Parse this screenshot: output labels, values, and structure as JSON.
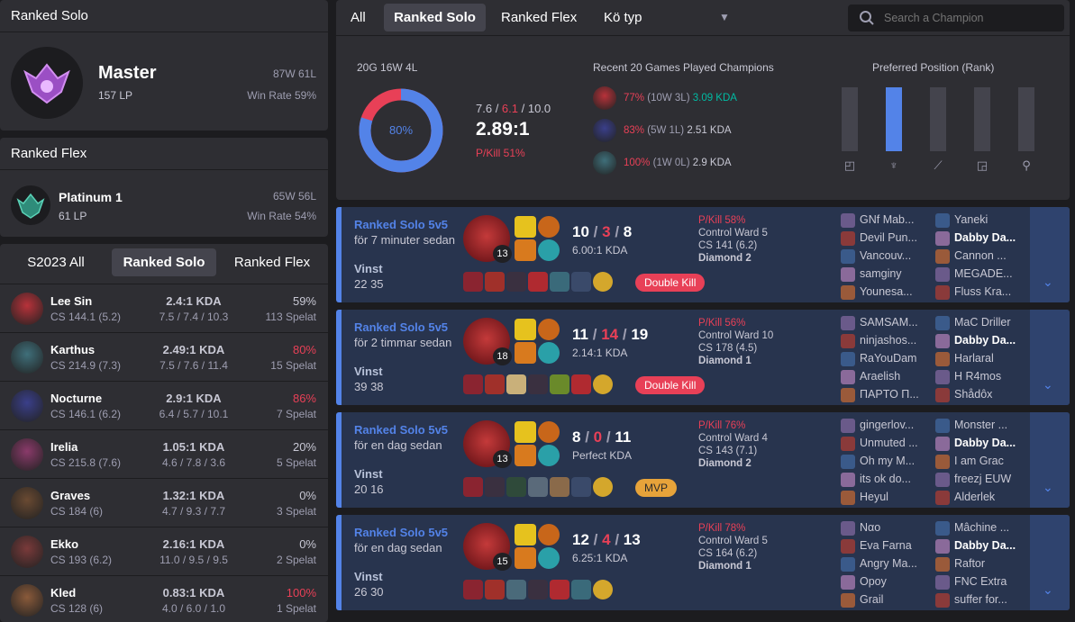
{
  "ranked_solo": {
    "title": "Ranked Solo",
    "tier": "Master",
    "lp": "157 LP",
    "record": "87W 61L",
    "winrate": "Win Rate 59%"
  },
  "ranked_flex": {
    "title": "Ranked Flex",
    "tier": "Platinum 1",
    "lp": "61 LP",
    "record": "65W 56L",
    "winrate": "Win Rate 54%"
  },
  "season_tabs": {
    "all": "S2023 All",
    "solo": "Ranked Solo",
    "flex": "Ranked Flex"
  },
  "champions": [
    {
      "name": "Lee Sin",
      "cs": "CS 144.1 (5.2)",
      "kda": "2.4:1 KDA",
      "stats": "7.5 / 7.4 / 10.3",
      "winrate": "59%",
      "games": "113 Spelat",
      "wr_color": "#c8c8d4",
      "icon_color": "#b8323a"
    },
    {
      "name": "Karthus",
      "cs": "CS 214.9 (7.3)",
      "kda": "2.49:1 KDA",
      "stats": "7.5 / 7.6 / 11.4",
      "winrate": "80%",
      "games": "15 Spelat",
      "wr_color": "#e84057",
      "icon_color": "#3f6f7a"
    },
    {
      "name": "Nocturne",
      "cs": "CS 146.1 (6.2)",
      "kda": "2.9:1 KDA",
      "stats": "6.4 / 5.7 / 10.1",
      "winrate": "86%",
      "games": "7 Spelat",
      "wr_color": "#e84057",
      "icon_color": "#3a3f8a"
    },
    {
      "name": "Irelia",
      "cs": "CS 215.8 (7.6)",
      "kda": "1.05:1 KDA",
      "stats": "4.6 / 7.8 / 3.6",
      "winrate": "20%",
      "games": "5 Spelat",
      "wr_color": "#c8c8d4",
      "icon_color": "#8a3a6a"
    },
    {
      "name": "Graves",
      "cs": "CS 184 (6)",
      "kda": "1.32:1 KDA",
      "stats": "4.7 / 9.3 / 7.7",
      "winrate": "0%",
      "games": "3 Spelat",
      "wr_color": "#c8c8d4",
      "icon_color": "#6a4a32"
    },
    {
      "name": "Ekko",
      "cs": "CS 193 (6.2)",
      "kda": "2.16:1 KDA",
      "stats": "11.0 / 9.5 / 9.5",
      "winrate": "0%",
      "games": "2 Spelat",
      "wr_color": "#c8c8d4",
      "icon_color": "#7a3a3a"
    },
    {
      "name": "Kled",
      "cs": "CS 128 (6)",
      "kda": "0.83:1 KDA",
      "stats": "4.0 / 6.0 / 1.0",
      "winrate": "100%",
      "games": "1 Spelat",
      "wr_color": "#e84057",
      "icon_color": "#8a5a3a"
    }
  ],
  "queue_tabs": {
    "all": "All",
    "solo": "Ranked Solo",
    "flex": "Ranked Flex",
    "type": "Kö typ"
  },
  "search": {
    "placeholder": "Search a Champion"
  },
  "summary": {
    "record": "20G 16W 4L",
    "donut_pct": "80%",
    "donut_value": 0.8,
    "kills": "7.6",
    "deaths": "6.1",
    "assists": "10.0",
    "ratio": "2.89:1",
    "pkill": "P/Kill 51%",
    "recent_title": "Recent 20 Games Played Champions",
    "recent": [
      {
        "wr": "77%",
        "rec": "(10W 3L)",
        "kda": "3.09 KDA",
        "kda_color": "#00bba3",
        "icon_color": "#b8323a"
      },
      {
        "wr": "83%",
        "rec": "(5W 1L)",
        "kda": "2.51 KDA",
        "kda_color": "#c8c8d4",
        "icon_color": "#3a3f8a"
      },
      {
        "wr": "100%",
        "rec": "(1W 0L)",
        "kda": "2.9 KDA",
        "kda_color": "#c8c8d4",
        "icon_color": "#3f6f7a"
      }
    ],
    "position_title": "Preferred Position (Rank)",
    "positions": [
      {
        "name": "top-icon",
        "share": 0
      },
      {
        "name": "jungle-icon",
        "share": 1
      },
      {
        "name": "mid-icon",
        "share": 0
      },
      {
        "name": "bottom-icon",
        "share": 0
      },
      {
        "name": "support-icon",
        "share": 0
      }
    ]
  },
  "matches": [
    {
      "queue": "Ranked Solo 5v5",
      "when": "för 7 minuter sedan",
      "result": "Vinst",
      "duration": "22 35",
      "level": "13",
      "k": "10",
      "d": "3",
      "a": "8",
      "kda": "6.00:1 KDA",
      "pkill": "P/Kill 58%",
      "ward": "Control Ward 5",
      "cs": "CS 141 (6.2)",
      "rank": "Diamond 2",
      "badge": "Double Kill",
      "badge_type": "kill",
      "team1": [
        "GNf Mab...",
        "Devil Pun...",
        "Vancouv...",
        "samginy",
        "Younesa..."
      ],
      "team2": [
        "Yaneki",
        "Dabby Da...",
        "Cannon ...",
        "MEGADE...",
        "Fluss Kra..."
      ]
    },
    {
      "queue": "Ranked Solo 5v5",
      "when": "för 2 timmar sedan",
      "result": "Vinst",
      "duration": "39 38",
      "level": "18",
      "k": "11",
      "d": "14",
      "a": "19",
      "kda": "2.14:1 KDA",
      "pkill": "P/Kill 56%",
      "ward": "Control Ward 10",
      "cs": "CS 178 (4.5)",
      "rank": "Diamond 1",
      "badge": "Double Kill",
      "badge_type": "kill",
      "team1": [
        "SAMSAM...",
        "ninjashos...",
        "RaYouDam",
        "Araelish",
        "ΠΑΡΤΟ Π..."
      ],
      "team2": [
        "MaC Driller",
        "Dabby Da...",
        "Harlaral",
        "H R4mos",
        "Shådôx"
      ]
    },
    {
      "queue": "Ranked Solo 5v5",
      "when": "för en dag sedan",
      "result": "Vinst",
      "duration": "20 16",
      "level": "13",
      "k": "8",
      "d": "0",
      "a": "11",
      "kda": "Perfect KDA",
      "pkill": "P/Kill 76%",
      "ward": "Control Ward 4",
      "cs": "CS 143 (7.1)",
      "rank": "Diamond 2",
      "badge": "MVP",
      "badge_type": "mvp",
      "team1": [
        "gingerlov...",
        "Unmuted ...",
        "Oh my M...",
        "its ok do...",
        "Heyul"
      ],
      "team2": [
        "Monster ...",
        "Dabby Da...",
        "I am Grac",
        "freezj EUW",
        "Alderlek"
      ]
    },
    {
      "queue": "Ranked Solo 5v5",
      "when": "för en dag sedan",
      "result": "Vinst",
      "duration": "26 30",
      "level": "15",
      "k": "12",
      "d": "4",
      "a": "13",
      "kda": "6.25:1 KDA",
      "pkill": "P/Kill 78%",
      "ward": "Control Ward 5",
      "cs": "CS 164 (6.2)",
      "rank": "Diamond 1",
      "badge": "",
      "badge_type": "none",
      "team1": [
        "Nαo",
        "Eva Farna",
        "Angry Ma...",
        "Opoy",
        "Grail"
      ],
      "team2": [
        "Mâchine ...",
        "Dabby Da...",
        "Raftor",
        "FNC Extra",
        "suffer for..."
      ]
    }
  ],
  "colors": {
    "accent": "#5383e8",
    "loss": "#e84057",
    "win_bg": "#28344e",
    "panel": "#2e2e33",
    "mvp": "#e7a33a"
  }
}
